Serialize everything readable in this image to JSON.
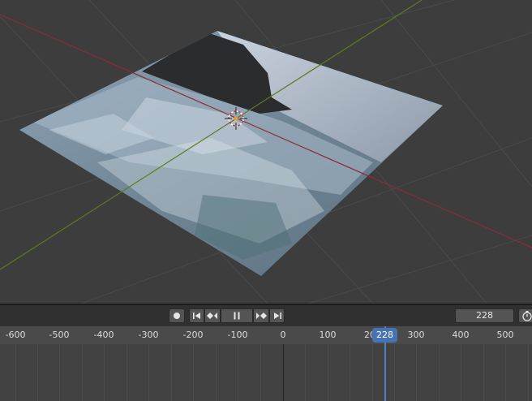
{
  "viewport": {
    "image_description_icon": "ocean-waves-image-plane",
    "axis_x_color": "#8c2b3a",
    "axis_y_color": "#5b7a1e",
    "grid_color": "#4a4a4a",
    "background_color": "#3d3d3d"
  },
  "timeline": {
    "current_frame": "228",
    "playhead_label": "228",
    "ruler_labels": [
      "-600",
      "-500",
      "-400",
      "-300",
      "-200",
      "-100",
      "0",
      "100",
      "20",
      "300",
      "400",
      "500"
    ],
    "accent_color": "#4772b3",
    "icons": {
      "record": "record-icon",
      "jump_start": "jump-to-start-icon",
      "prev_keyframe": "previous-keyframe-icon",
      "pause": "pause-icon",
      "next_keyframe": "next-keyframe-icon",
      "jump_end": "jump-to-end-icon",
      "stopwatch": "stopwatch-icon"
    }
  }
}
